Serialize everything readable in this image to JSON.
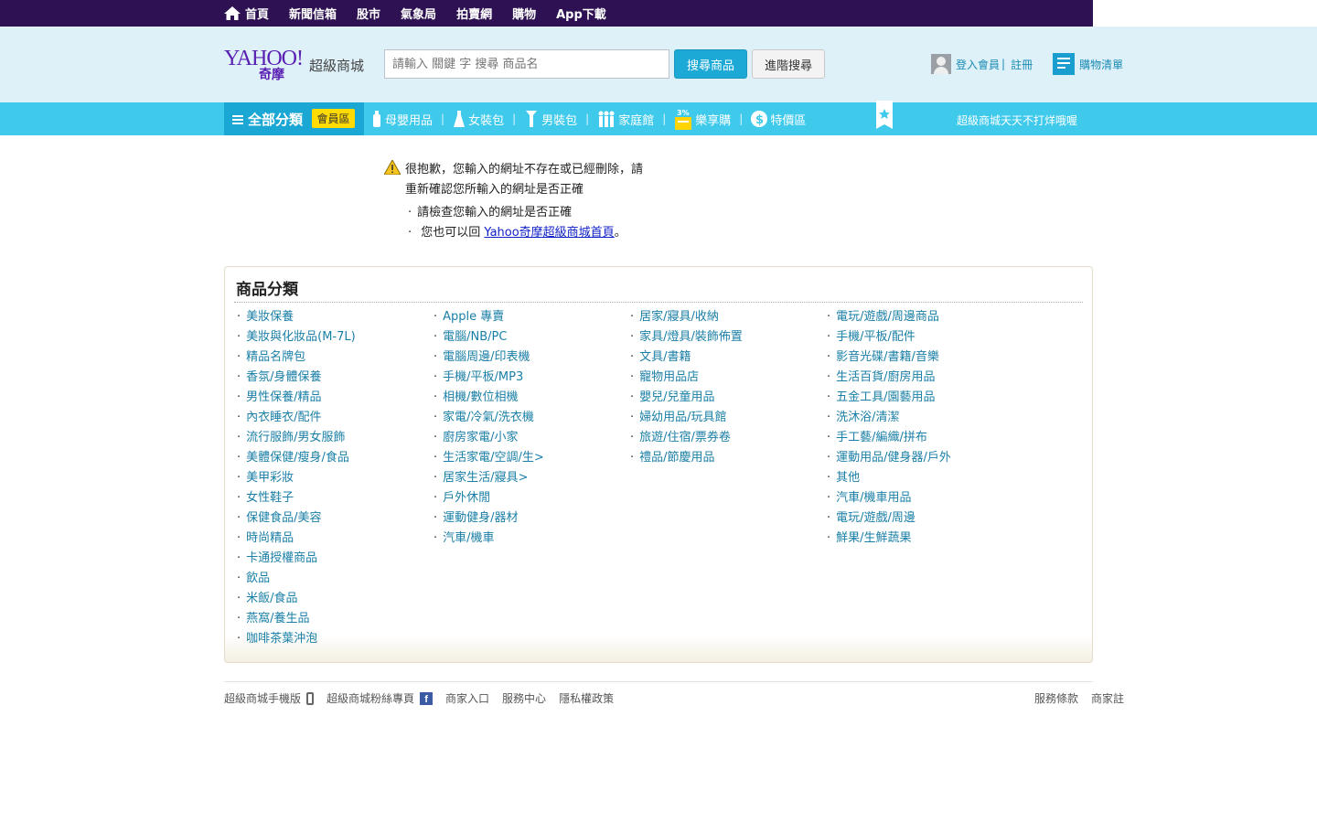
{
  "topnav": {
    "items": [
      "首頁",
      "新聞信箱",
      "股市",
      "氣象局",
      "拍賣網",
      "購物",
      "App下載"
    ]
  },
  "header": {
    "logo_text": "YAHOO!",
    "logo_sub": "奇摩",
    "logo_mall": "超級商城",
    "search_placeholder": "請輸入 關鍵 字 搜尋 商品名",
    "search_button": "搜尋商品",
    "adv_button": "進階搜尋",
    "login_label": "登入會員",
    "register_label": "註冊",
    "cart_label": "購物清單"
  },
  "catnav": {
    "all_label": "全部分類",
    "vip_label": "會員區",
    "items": [
      "母嬰用品",
      "女裝包",
      "男裝包",
      "家庭館",
      "樂享購",
      "特價區"
    ],
    "promo": "超級商城天天不打烊哦喔"
  },
  "notice": {
    "title": "很抱歉，您輸入的網址不存在或已經刪除，請重新確認您所輸入的網址是否正確",
    "items": [
      {
        "text": "請檢查您輸入的網址是否正確"
      },
      {
        "prefix": "您也可以回 ",
        "link": "Yahoo奇摩超級商城首頁",
        "suffix": "。"
      }
    ]
  },
  "directory": {
    "title": "商品分類",
    "columns": [
      [
        "美妝保養",
        "美妝與化妝品(M-7L)",
        "精品名牌包",
        "香氛/身體保養",
        "男性保養/精品",
        "內衣睡衣/配件",
        "流行服飾/男女服飾",
        "美體保健/瘦身/食品",
        "美甲彩妝",
        "女性鞋子",
        "保健食品/美容",
        "時尚精品",
        "卡通授權商品",
        "飲品",
        "米飯/食品",
        "燕窩/養生品",
        "咖啡茶葉沖泡"
      ],
      [
        "Apple 專賣",
        "電腦/NB/PC",
        "電腦周邊/印表機",
        "手機/平板/MP3",
        "相機/數位相機",
        "家電/冷氣/洗衣機",
        "廚房家電/小家",
        "生活家電/空調/生>",
        "居家生活/寢具>",
        "戶外休閒",
        "運動健身/器材",
        "汽車/機車"
      ],
      [
        "居家/寢具/收納",
        "家具/燈具/裝飾佈置",
        "文具/書籍",
        "寵物用品店",
        "嬰兒/兒童用品",
        "婦幼用品/玩具館",
        "旅遊/住宿/票券卷",
        "禮品/節慶用品"
      ],
      [
        "電玩/遊戲/周邊商品",
        "手機/平板/配件",
        "影音光碟/書籍/音樂",
        "生活百貨/廚房用品",
        "五金工具/園藝用品",
        "洗沐浴/清潔",
        "手工藝/編織/拼布",
        "運動用品/健身器/戶外",
        "其他",
        "汽車/機車用品",
        "電玩/遊戲/周邊",
        "鮮果/生鮮蔬果"
      ]
    ]
  },
  "footer": {
    "left": [
      "超級商城手機版",
      "超級商城粉絲專頁",
      "商家入口",
      "服務中心",
      "隱私權政策"
    ],
    "right": [
      "服務條款",
      "商家註"
    ]
  }
}
